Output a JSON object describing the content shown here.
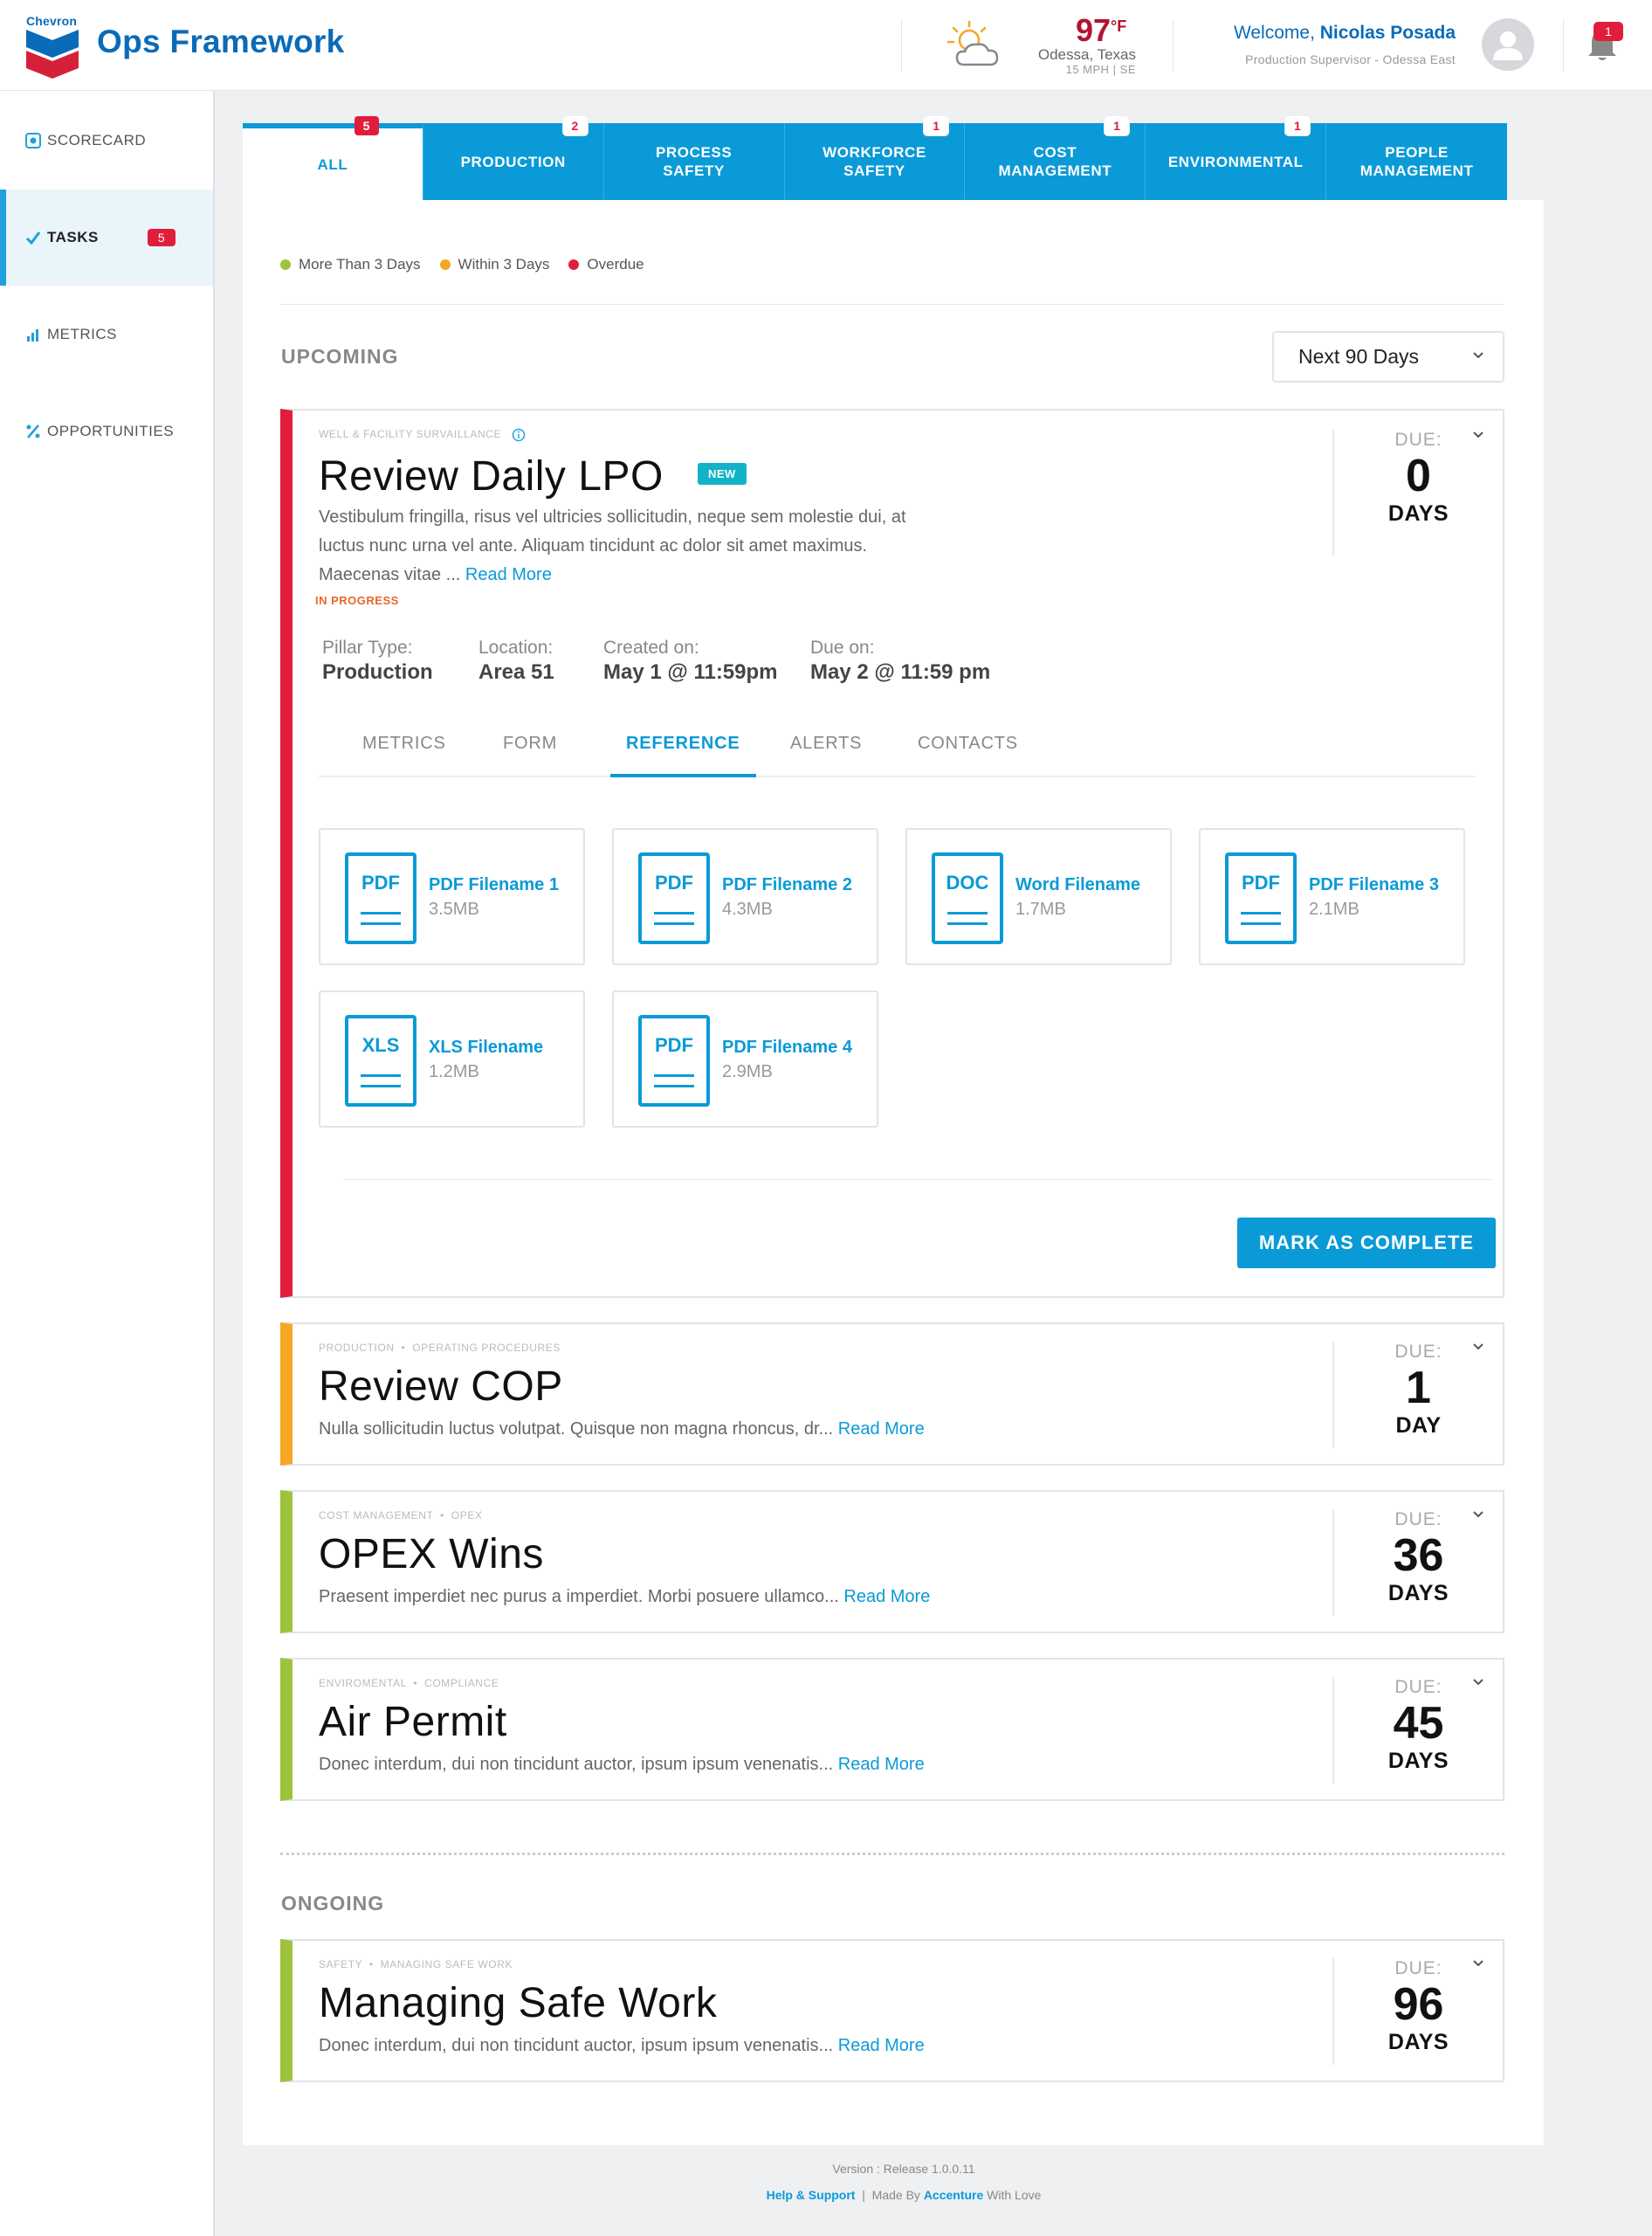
{
  "header": {
    "brand": "Chevron",
    "app_title": "Ops Framework",
    "temperature": "97",
    "temp_unit": "°F",
    "city": "Odessa, Texas",
    "wind": "15 MPH | SE",
    "welcome_prefix": "Welcome,",
    "user_name": "Nicolas Posada",
    "role": "Production Supervisor - Odessa  East",
    "notifications": "1"
  },
  "sidebar": {
    "items": [
      {
        "label": "SCORECARD",
        "icon": "scorecard-icon"
      },
      {
        "label": "TASKS",
        "icon": "check-icon",
        "badge": "5"
      },
      {
        "label": "METRICS",
        "icon": "bar-chart-icon"
      },
      {
        "label": "OPPORTUNITIES",
        "icon": "percent-icon"
      }
    ]
  },
  "tabs": [
    {
      "label": "ALL",
      "badge": "5"
    },
    {
      "label": "PRODUCTION",
      "badge": "2"
    },
    {
      "label": "PROCESS SAFETY",
      "badge": ""
    },
    {
      "label": "WORKFORCE SAFETY",
      "badge": "1"
    },
    {
      "label": "COST MANAGEMENT",
      "badge": "1"
    },
    {
      "label": "ENVIRONMENTAL",
      "badge": "1"
    },
    {
      "label": "PEOPLE MANAGEMENT",
      "badge": ""
    }
  ],
  "legend": [
    {
      "label": "More Than 3 Days",
      "color": "#9dc33b"
    },
    {
      "label": "Within 3 Days",
      "color": "#f5a623"
    },
    {
      "label": "Overdue",
      "color": "#e01e3c"
    }
  ],
  "upcoming": {
    "title": "UPCOMING",
    "range": "Next 90 Days"
  },
  "ongoing": {
    "title": "ONGOING"
  },
  "due_label": "DUE:",
  "read_more": "Read More",
  "expanded_task": {
    "category": "WELL & FACILITY SURVAILLANCE",
    "title": "Review Daily LPO",
    "badge": "NEW",
    "desc_line1": "Vestibulum fringilla, risus vel ultricies sollicitudin, neque sem molestie dui, at",
    "desc_line2": "luctus nunc urna vel ante. Aliquam tincidunt ac dolor sit amet maximus.",
    "desc_line3": "Maecenas vitae ...",
    "status": "IN PROGRESS",
    "due_num": "0",
    "due_unit": "DAYS",
    "meta": [
      {
        "label": "Pillar Type:",
        "value": "Production"
      },
      {
        "label": "Location:",
        "value": "Area 51"
      },
      {
        "label": "Created on:",
        "value": "May 1 @ 11:59pm"
      },
      {
        "label": "Due on:",
        "value": "May 2 @ 11:59 pm"
      }
    ],
    "subtabs": [
      "METRICS",
      "FORM",
      "REFERENCE",
      "ALERTS",
      "CONTACTS"
    ],
    "files": [
      {
        "ext": "PDF",
        "name": "PDF Filename 1",
        "size": "3.5MB"
      },
      {
        "ext": "PDF",
        "name": "PDF Filename 2",
        "size": "4.3MB"
      },
      {
        "ext": "DOC",
        "name": "Word Filename",
        "size": "1.7MB"
      },
      {
        "ext": "PDF",
        "name": "PDF Filename 3",
        "size": "2.1MB"
      },
      {
        "ext": "XLS",
        "name": "XLS Filename",
        "size": "1.2MB"
      },
      {
        "ext": "PDF",
        "name": "PDF Filename 4",
        "size": "2.9MB"
      }
    ],
    "complete_label": "MARK AS COMPLETE"
  },
  "tasks": [
    {
      "cat1": "PRODUCTION",
      "cat2": "OPERATING PROCEDURES",
      "title": "Review COP",
      "desc": "Nulla sollicitudin luctus volutpat. Quisque non magna rhoncus, dr...",
      "due_num": "1",
      "due_unit": "DAY",
      "color": "#f5a623"
    },
    {
      "cat1": "COST MANAGEMENT",
      "cat2": "OPEX",
      "title": "OPEX Wins",
      "desc": "Praesent imperdiet nec purus a imperdiet. Morbi posuere ullamco...",
      "due_num": "36",
      "due_unit": "DAYS",
      "color": "#9dc33b"
    },
    {
      "cat1": "ENVIROMENTAL",
      "cat2": "COMPLIANCE",
      "title": "Air Permit",
      "desc": "Donec interdum, dui non tincidunt auctor, ipsum ipsum venenatis...",
      "due_num": "45",
      "due_unit": "DAYS",
      "color": "#9dc33b"
    }
  ],
  "ongoing_task": {
    "cat1": "SAFETY",
    "cat2": "MANAGING SAFE WORK",
    "title": "Managing Safe Work",
    "desc": "Donec interdum, dui non tincidunt auctor, ipsum ipsum venenatis...",
    "due_num": "96",
    "due_unit": "DAYS",
    "color": "#9dc33b"
  },
  "footer": {
    "version": "Version : Release 1.0.0.11",
    "help": "Help & Support",
    "made_by": "Made By",
    "company": "Accenture",
    "suffix": "With Love"
  },
  "colors": {
    "accent": "#0a9ad8",
    "brand": "#0a6bb8",
    "overdue": "#e01e3c"
  }
}
